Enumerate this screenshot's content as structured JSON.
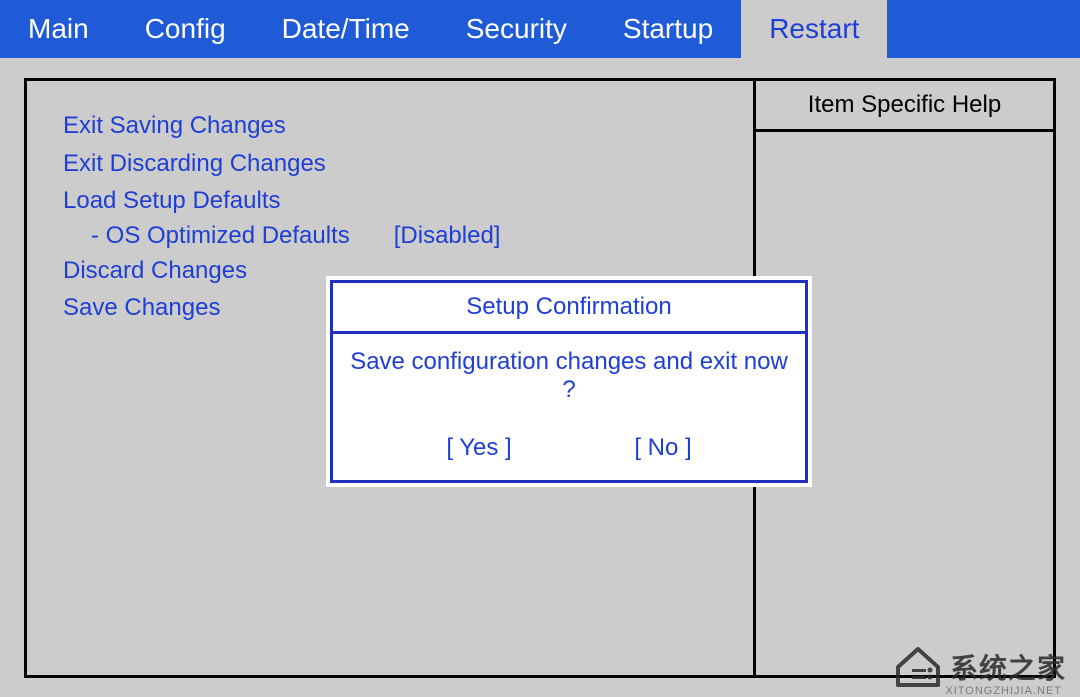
{
  "menubar": {
    "items": [
      {
        "label": "Main"
      },
      {
        "label": "Config"
      },
      {
        "label": "Date/Time"
      },
      {
        "label": "Security"
      },
      {
        "label": "Startup"
      },
      {
        "label": "Restart"
      }
    ],
    "active_index": 5
  },
  "restart_menu": {
    "items": [
      {
        "label": "Exit Saving Changes"
      },
      {
        "label": "Exit Discarding Changes"
      },
      {
        "label": "Load Setup Defaults"
      }
    ],
    "sub_item": {
      "label": "- OS Optimized Defaults",
      "value": "[Disabled]"
    },
    "items_after": [
      {
        "label": "Discard Changes"
      },
      {
        "label": "Save Changes"
      }
    ]
  },
  "help_panel": {
    "title": "Item Specific Help"
  },
  "dialog": {
    "title": "Setup Confirmation",
    "message": "Save configuration changes and exit now ?",
    "yes_label": "[ Yes ]",
    "no_label": "[ No ]"
  },
  "watermark": {
    "text": "系统之家",
    "sub": "XITONGZHIJIA.NET"
  }
}
